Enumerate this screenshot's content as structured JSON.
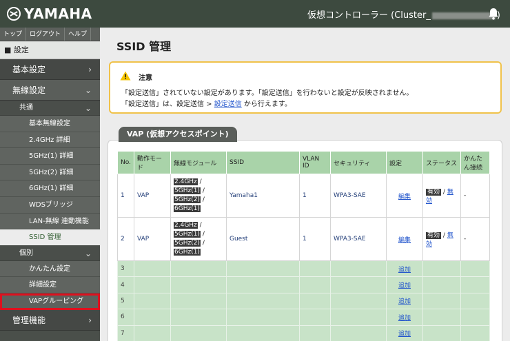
{
  "header": {
    "brand": "YAMAHA",
    "title_prefix": "仮想コントローラー (Cluster_",
    "title_suffix": ")"
  },
  "sidebar": {
    "top_nav": [
      "トップ",
      "ログアウト",
      "ヘルプ"
    ],
    "section": "■ 設定",
    "items": [
      {
        "label": "基本設定",
        "chevron": "›"
      },
      {
        "label": "無線設定",
        "chevron": "⌄"
      },
      {
        "label": "共通",
        "chevron": "⌄"
      },
      {
        "label": "基本無線設定"
      },
      {
        "label": "2.4GHz 詳細"
      },
      {
        "label": "5GHz(1) 詳細"
      },
      {
        "label": "5GHz(2) 詳細"
      },
      {
        "label": "6GHz(1) 詳細"
      },
      {
        "label": "WDSブリッジ"
      },
      {
        "label": "LAN-無線 連動機能"
      },
      {
        "label": "SSID 管理"
      },
      {
        "label": "個別",
        "chevron": "⌄"
      },
      {
        "label": "かんたん設定"
      },
      {
        "label": "詳細設定"
      },
      {
        "label": "VAPグルーピング"
      },
      {
        "label": "管理機能",
        "chevron": "›"
      }
    ]
  },
  "main": {
    "title": "SSID 管理",
    "notice": {
      "title": "注意",
      "line1": "「設定送信」されていない設定があります。「設定送信」を行わないと設定が反映されません。",
      "line2_prefix": "「設定送信」は、設定送信 > ",
      "line2_link": "設定送信",
      "line2_suffix": " から行えます。"
    },
    "vap_title": "VAP (仮想アクセスポイント)",
    "table": {
      "headers": [
        "No.",
        "動作モード",
        "無線モジュール",
        "SSID",
        "VLAN ID",
        "セキュリティ",
        "設定",
        "ステータス",
        "かんたん接続"
      ],
      "rows": [
        {
          "no": "1",
          "mode": "VAP",
          "modules": [
            "2.4GHz",
            "5GHz(1)",
            "5GHz(2)",
            "6GHz(1)"
          ],
          "sep": "/",
          "ssid": "Yamaha1",
          "vlan": "1",
          "security": "WPA3-SAE",
          "action": "編集",
          "status_on": "有効",
          "status_off": "無効",
          "easy": "-"
        },
        {
          "no": "2",
          "mode": "VAP",
          "modules": [
            "2.4GHz",
            "5GHz(1)",
            "5GHz(2)",
            "6GHz(1)"
          ],
          "sep": "/",
          "ssid": "Guest",
          "vlan": "1",
          "security": "WPA3-SAE",
          "action": "編集",
          "status_on": "有効",
          "status_off": "無効",
          "easy": "-"
        }
      ],
      "empty_rows": [
        {
          "no": "3",
          "action": "追加"
        },
        {
          "no": "4",
          "action": "追加"
        },
        {
          "no": "5",
          "action": "追加"
        },
        {
          "no": "6",
          "action": "追加"
        },
        {
          "no": "7",
          "action": "追加"
        }
      ]
    }
  }
}
